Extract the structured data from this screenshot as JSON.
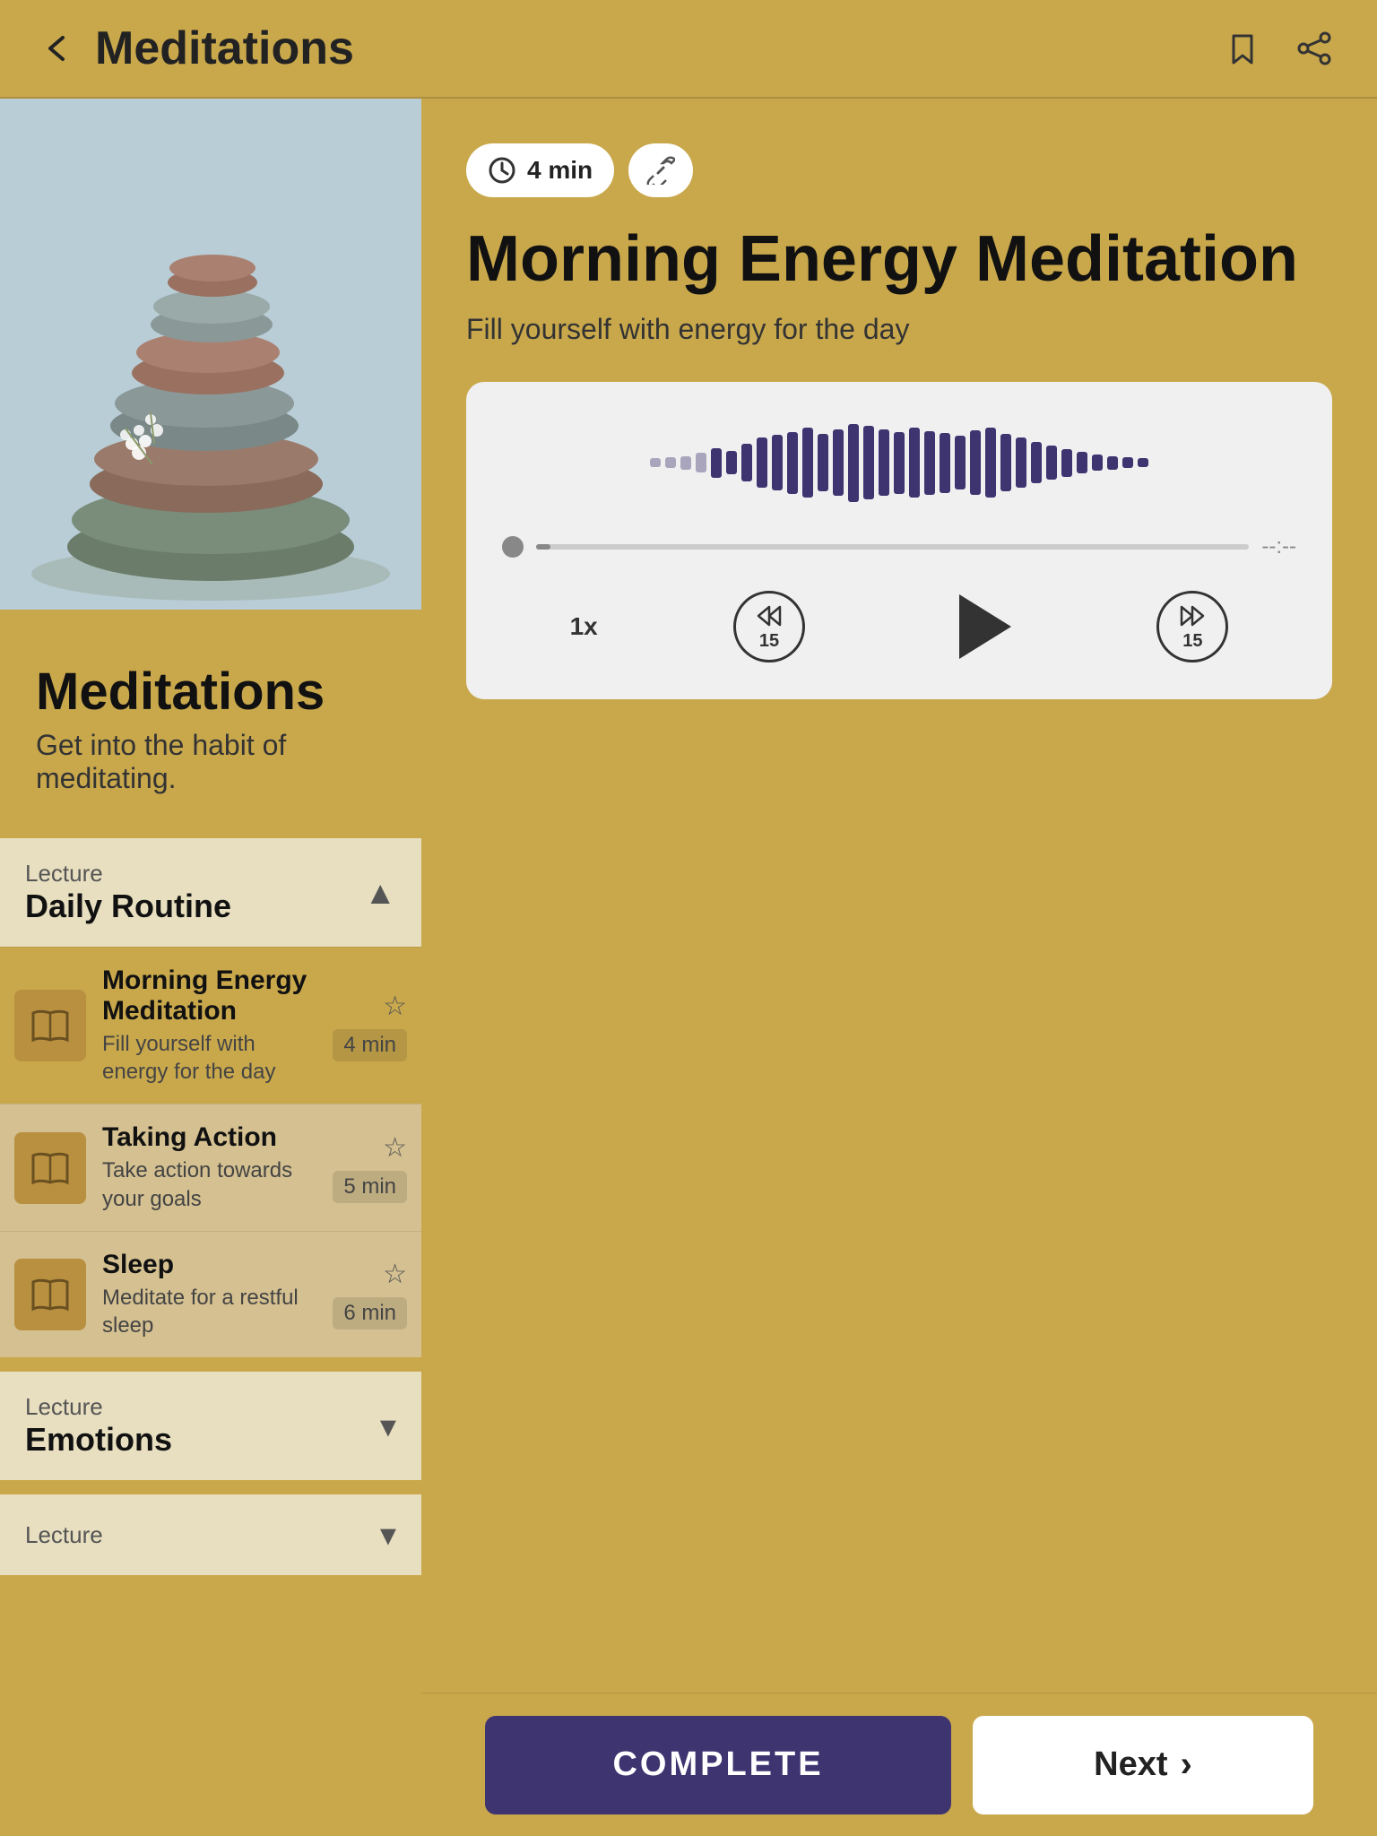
{
  "header": {
    "title": "Meditations",
    "back_label": "‹",
    "bookmark_icon": "bookmark",
    "share_icon": "share"
  },
  "left_panel": {
    "section_title": "Meditations",
    "section_subtitle": "Get into the habit of meditating.",
    "lectures": [
      {
        "id": "daily-routine",
        "label": "Lecture",
        "name": "Daily Routine",
        "expanded": true,
        "chevron": "▲",
        "lessons": [
          {
            "id": "morning-energy",
            "title": "Morning Energy Meditation",
            "description": "Fill yourself with energy for the day",
            "duration": "4 min",
            "active": true
          },
          {
            "id": "taking-action",
            "title": "Taking Action",
            "description": "Take action towards your goals",
            "duration": "5 min",
            "active": false
          },
          {
            "id": "sleep",
            "title": "Sleep",
            "description": "Meditate for a restful sleep",
            "duration": "6 min",
            "active": false
          }
        ]
      },
      {
        "id": "emotions",
        "label": "Lecture",
        "name": "Emotions",
        "expanded": false,
        "chevron": "▾",
        "lessons": []
      },
      {
        "id": "lecture3",
        "label": "Lecture",
        "name": "",
        "expanded": false,
        "chevron": "▾",
        "lessons": []
      }
    ]
  },
  "right_panel": {
    "duration": "4 min",
    "title": "Morning Energy Meditation",
    "description": "Fill yourself with energy for the day",
    "time_remaining": "--:--",
    "speed": "1x",
    "skip_back": "15",
    "skip_forward": "15"
  },
  "bottom_bar": {
    "complete_label": "COMPLETE",
    "next_label": "Next"
  },
  "waveform_bars": [
    4,
    7,
    10,
    18,
    30,
    22,
    40,
    55,
    62,
    70,
    80,
    65,
    75,
    90,
    85,
    75,
    70,
    80,
    72,
    68,
    60,
    74,
    80,
    65,
    55,
    45,
    35,
    28,
    20,
    14,
    10,
    7,
    5
  ]
}
